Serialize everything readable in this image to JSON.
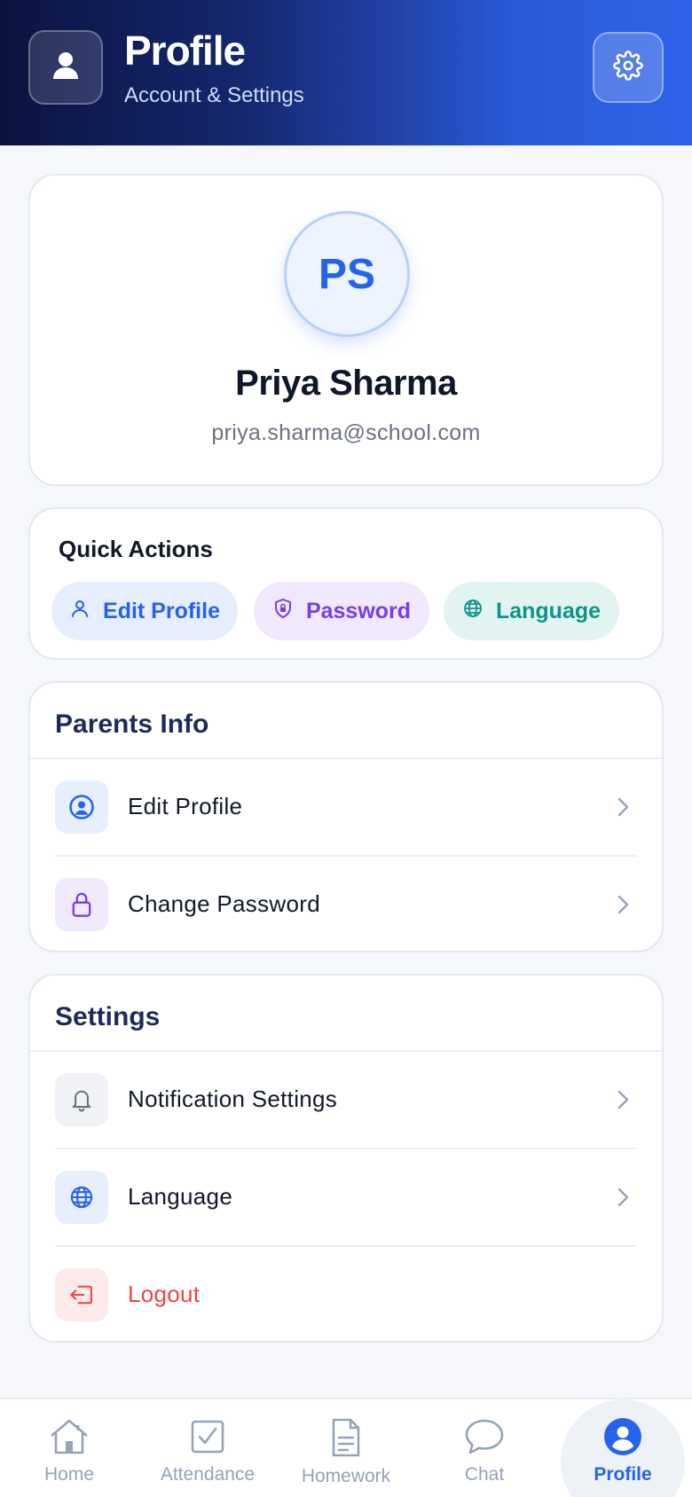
{
  "header": {
    "title": "Profile",
    "subtitle": "Account & Settings",
    "avatar_icon": "user-icon",
    "settings_icon": "gear-icon"
  },
  "profile": {
    "initials": "PS",
    "name": "Priya Sharma",
    "email": "priya.sharma@school.com"
  },
  "quick_actions": {
    "title": "Quick Actions",
    "items": [
      {
        "label": "Edit Profile",
        "icon": "user-outline-icon",
        "color": "#2563eb"
      },
      {
        "label": "Password",
        "icon": "shield-lock-icon",
        "color": "#7c3aed"
      },
      {
        "label": "Language",
        "icon": "globe-icon",
        "color": "#0d9488"
      }
    ]
  },
  "parents_info": {
    "title": "Parents Info",
    "items": [
      {
        "label": "Edit Profile",
        "icon": "user-circle-icon"
      },
      {
        "label": "Change Password",
        "icon": "lock-icon"
      }
    ]
  },
  "settings": {
    "title": "Settings",
    "items": [
      {
        "label": "Notification Settings",
        "icon": "bell-icon"
      },
      {
        "label": "Language",
        "icon": "globe-icon"
      },
      {
        "label": "Logout",
        "icon": "logout-icon",
        "color": "#ef4444"
      }
    ]
  },
  "bottom_nav": {
    "items": [
      {
        "label": "Home",
        "icon": "home-icon"
      },
      {
        "label": "Attendance",
        "icon": "checkbox-icon"
      },
      {
        "label": "Homework",
        "icon": "document-icon"
      },
      {
        "label": "Chat",
        "icon": "chat-bubble-icon"
      },
      {
        "label": "Profile",
        "icon": "profile-icon",
        "active": true
      }
    ]
  },
  "colors": {
    "accent": "#2563eb",
    "header_dark": "#0b1440",
    "danger": "#ef4444"
  }
}
